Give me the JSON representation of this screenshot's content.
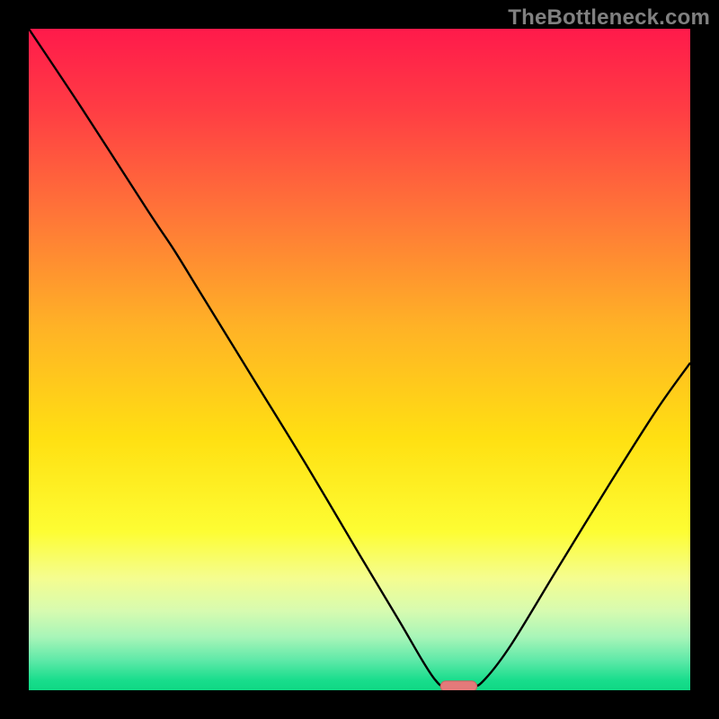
{
  "watermark": "TheBottleneck.com",
  "chart_data": {
    "type": "line",
    "title": "",
    "xlabel": "",
    "ylabel": "",
    "xlim": [
      0,
      100
    ],
    "ylim": [
      0,
      100
    ],
    "background_gradient": {
      "stops": [
        {
          "offset": 0.0,
          "color": "#ff1a4b"
        },
        {
          "offset": 0.12,
          "color": "#ff3c44"
        },
        {
          "offset": 0.28,
          "color": "#ff7538"
        },
        {
          "offset": 0.45,
          "color": "#ffb226"
        },
        {
          "offset": 0.62,
          "color": "#ffe012"
        },
        {
          "offset": 0.76,
          "color": "#fdfd33"
        },
        {
          "offset": 0.83,
          "color": "#f5fd8f"
        },
        {
          "offset": 0.88,
          "color": "#d7fbb0"
        },
        {
          "offset": 0.92,
          "color": "#a7f5b8"
        },
        {
          "offset": 0.955,
          "color": "#5ee9a8"
        },
        {
          "offset": 0.985,
          "color": "#18dd8c"
        },
        {
          "offset": 1.0,
          "color": "#0fd884"
        }
      ]
    },
    "series": [
      {
        "name": "bottleneck-curve",
        "color": "#000000",
        "width": 2.4,
        "points": [
          {
            "x": 0.0,
            "y": 100.0
          },
          {
            "x": 8.0,
            "y": 88.0
          },
          {
            "x": 18.0,
            "y": 72.5
          },
          {
            "x": 22.0,
            "y": 66.5
          },
          {
            "x": 26.0,
            "y": 60.0
          },
          {
            "x": 34.0,
            "y": 47.0
          },
          {
            "x": 42.0,
            "y": 34.0
          },
          {
            "x": 50.0,
            "y": 20.5
          },
          {
            "x": 56.0,
            "y": 10.5
          },
          {
            "x": 59.5,
            "y": 4.5
          },
          {
            "x": 61.5,
            "y": 1.5
          },
          {
            "x": 63.0,
            "y": 0.5
          },
          {
            "x": 67.0,
            "y": 0.5
          },
          {
            "x": 69.0,
            "y": 1.7
          },
          {
            "x": 73.0,
            "y": 7.0
          },
          {
            "x": 80.0,
            "y": 18.5
          },
          {
            "x": 88.0,
            "y": 31.5
          },
          {
            "x": 95.0,
            "y": 42.5
          },
          {
            "x": 100.0,
            "y": 49.5
          }
        ]
      }
    ],
    "marker": {
      "name": "optimal-marker",
      "shape": "pill",
      "cx": 65.0,
      "cy": 0.6,
      "width": 5.5,
      "height": 1.6,
      "fill": "#e47a7a",
      "stroke": "#c86060"
    }
  }
}
